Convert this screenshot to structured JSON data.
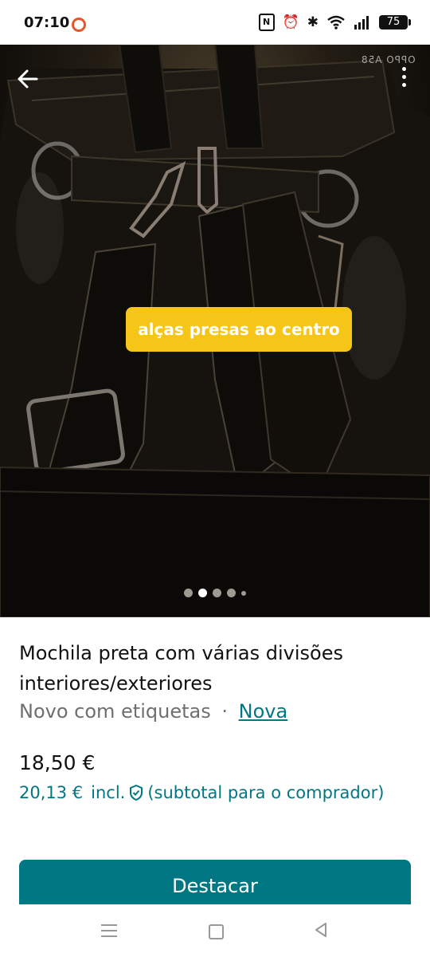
{
  "status_bar": {
    "time": "07:10",
    "battery": "75",
    "icons": [
      "nfc-icon",
      "alarm-icon",
      "bluetooth-icon",
      "wifi-icon",
      "signal-icon",
      "battery-icon"
    ]
  },
  "photo": {
    "watermark": "OPPO A58",
    "tag_text": "alças presas ao centro",
    "image_count": 5,
    "current_image": 2
  },
  "item": {
    "title": "Mochila preta com várias divisões interiores/exteriores",
    "condition": "Novo com etiquetas",
    "separator": "·",
    "condition_link": "Nova",
    "price": "18,50 €",
    "price_incl": "20,13 €",
    "incl_label": "incl.",
    "subtotal_label": "(subtotal para o comprador)"
  },
  "actions": {
    "promote_label": "Destacar"
  },
  "colors": {
    "accent": "#007782",
    "tag": "#f5c518"
  }
}
